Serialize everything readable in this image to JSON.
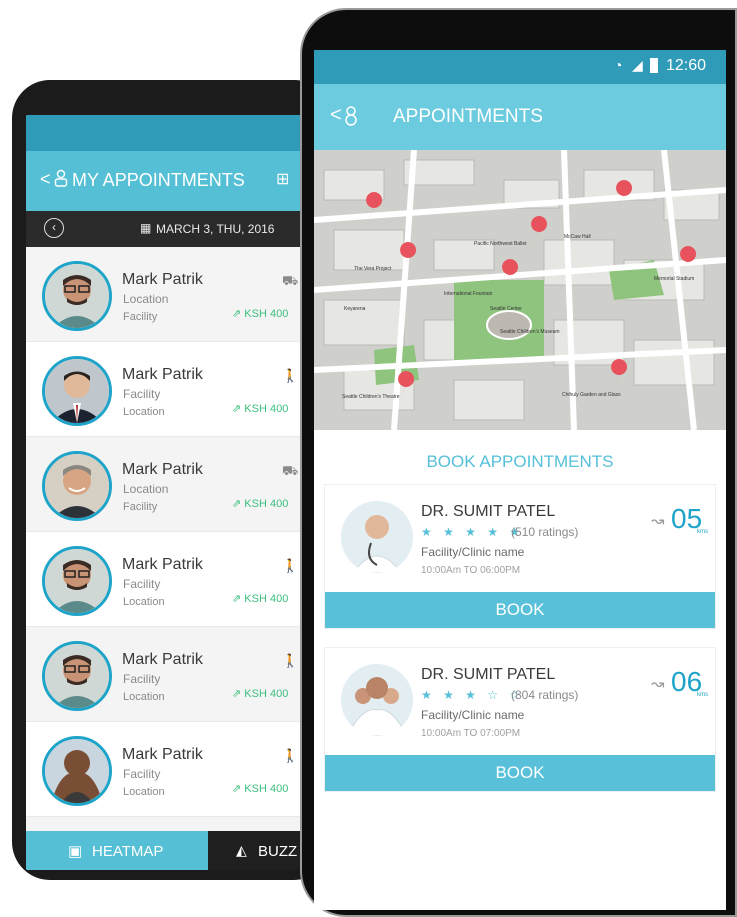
{
  "colors": {
    "teal": "#55bfd6",
    "dark_teal": "#2f9bb8",
    "green": "#3bbf7d",
    "text": "#3a3a3a"
  },
  "back_phone": {
    "header_title": "MY APPOINTMENTS",
    "date": "MARCH 3, THU, 2016",
    "items": [
      {
        "name": "Mark Patrik",
        "line1": "Location",
        "line2": "Facility",
        "price": "KSH 400",
        "icon": "car-icon"
      },
      {
        "name": "Mark Patrik",
        "line1": "Facility",
        "line2": "Location",
        "price": "KSH 400",
        "icon": "walk-icon"
      },
      {
        "name": "Mark Patrik",
        "line1": "Location",
        "line2": "Facility",
        "price": "KSH 400",
        "icon": "car-icon"
      },
      {
        "name": "Mark Patrik",
        "line1": "Facility",
        "line2": "Location",
        "price": "KSH 400",
        "icon": "walk-icon"
      },
      {
        "name": "Mark Patrik",
        "line1": "Facility",
        "line2": "Location",
        "price": "KSH 400",
        "icon": "walk-icon"
      },
      {
        "name": "Mark Patrik",
        "line1": "Facility",
        "line2": "Location",
        "price": "KSH 400",
        "icon": "walk-icon"
      }
    ],
    "bottom_tabs": [
      {
        "label": "HEATMAP"
      },
      {
        "label": "BUZZ"
      }
    ]
  },
  "front_phone": {
    "time": "12:60",
    "header_title": "APPOINTMENTS",
    "map_labels": [
      "Seattle Center",
      "Seattle Children's Museum",
      "Seattle Children's Theatre",
      "Chihuly Garden and Glass",
      "International Fountain",
      "Pacific Northwest Ballet",
      "Memorial Stadium",
      "Keyarena",
      "The Vera Project",
      "McCaw Hall"
    ],
    "section_title": "BOOK APPOINTMENTS",
    "doctors": [
      {
        "name": "DR. SUMIT PATEL",
        "rating": 5,
        "stars": "★ ★ ★ ★ ★",
        "ratings": "(510 ratings)",
        "facility": "Facility/Clinic name",
        "time": "10:00Am TO 06:00PM",
        "distance": "05",
        "unit": "kms",
        "button": "BOOK"
      },
      {
        "name": "DR. SUMIT PATEL",
        "rating": 3,
        "stars": "★ ★ ★ ☆ ☆",
        "ratings": "(804 ratings)",
        "facility": "Facility/Clinic name",
        "time": "10:00Am TO 07:00PM",
        "distance": "06",
        "unit": "kms",
        "button": "BOOK"
      }
    ]
  }
}
